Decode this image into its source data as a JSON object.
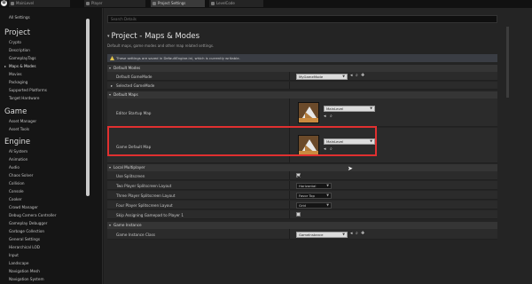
{
  "tabs": [
    {
      "label": "MainLevel",
      "active": false
    },
    {
      "label": "Player",
      "active": false
    },
    {
      "label": "Project Settings",
      "active": true
    },
    {
      "label": "LevelCode",
      "active": false
    }
  ],
  "sidebar": {
    "all_settings": "All Settings",
    "project_title": "Project",
    "project_items": [
      "Crypto",
      "Description",
      "GameplayTags",
      "Maps & Modes",
      "Movies",
      "Packaging",
      "Supported Platforms",
      "Target Hardware"
    ],
    "game_title": "Game",
    "game_items": [
      "Asset Manager",
      "Asset Tools"
    ],
    "engine_title": "Engine",
    "engine_items": [
      "AI System",
      "Animation",
      "Audio",
      "Chaos Solver",
      "Collision",
      "Console",
      "Cooker",
      "Crowd Manager",
      "Debug Camera Controller",
      "Gameplay Debugger",
      "Garbage Collection",
      "General Settings",
      "Hierarchical LOD",
      "Input",
      "Landscape",
      "Navigation Mesh",
      "Navigation System"
    ]
  },
  "main": {
    "search_placeholder": "Search Details",
    "title": "Project - Maps & Modes",
    "description": "Default maps, game modes and other map related settings.",
    "notice": "These settings are saved in DefaultEngine.ini, which is currently writable.",
    "sections": {
      "default_modes": {
        "title": "Default Modes",
        "default_gamemode_label": "Default GameMode",
        "default_gamemode_value": "MyGameMode",
        "selected_gamemode_label": "Selected GameMode"
      },
      "default_maps": {
        "title": "Default Maps",
        "editor_startup_label": "Editor Startup Map",
        "editor_startup_value": "MainLevel",
        "game_default_label": "Game Default Map",
        "game_default_value": "MainLevel"
      },
      "local_multiplayer": {
        "title": "Local Multiplayer",
        "use_splitscreen_label": "Use Splitscreen",
        "two_player_label": "Two Player Splitscreen Layout",
        "two_player_value": "Horizontal",
        "three_player_label": "Three Player Splitscreen Layout",
        "three_player_value": "Favor Top",
        "four_player_label": "Four Player Splitscreen Layout",
        "four_player_value": "Grid",
        "skip_assigning_label": "Skip Assigning Gamepad to Player 1"
      },
      "game_instance": {
        "title": "Game Instance",
        "class_label": "Game Instance Class",
        "class_value": "GameInstance"
      }
    }
  },
  "colors": {
    "highlight": "#e03030",
    "panel": "#242424",
    "sidebar": "#151515"
  }
}
